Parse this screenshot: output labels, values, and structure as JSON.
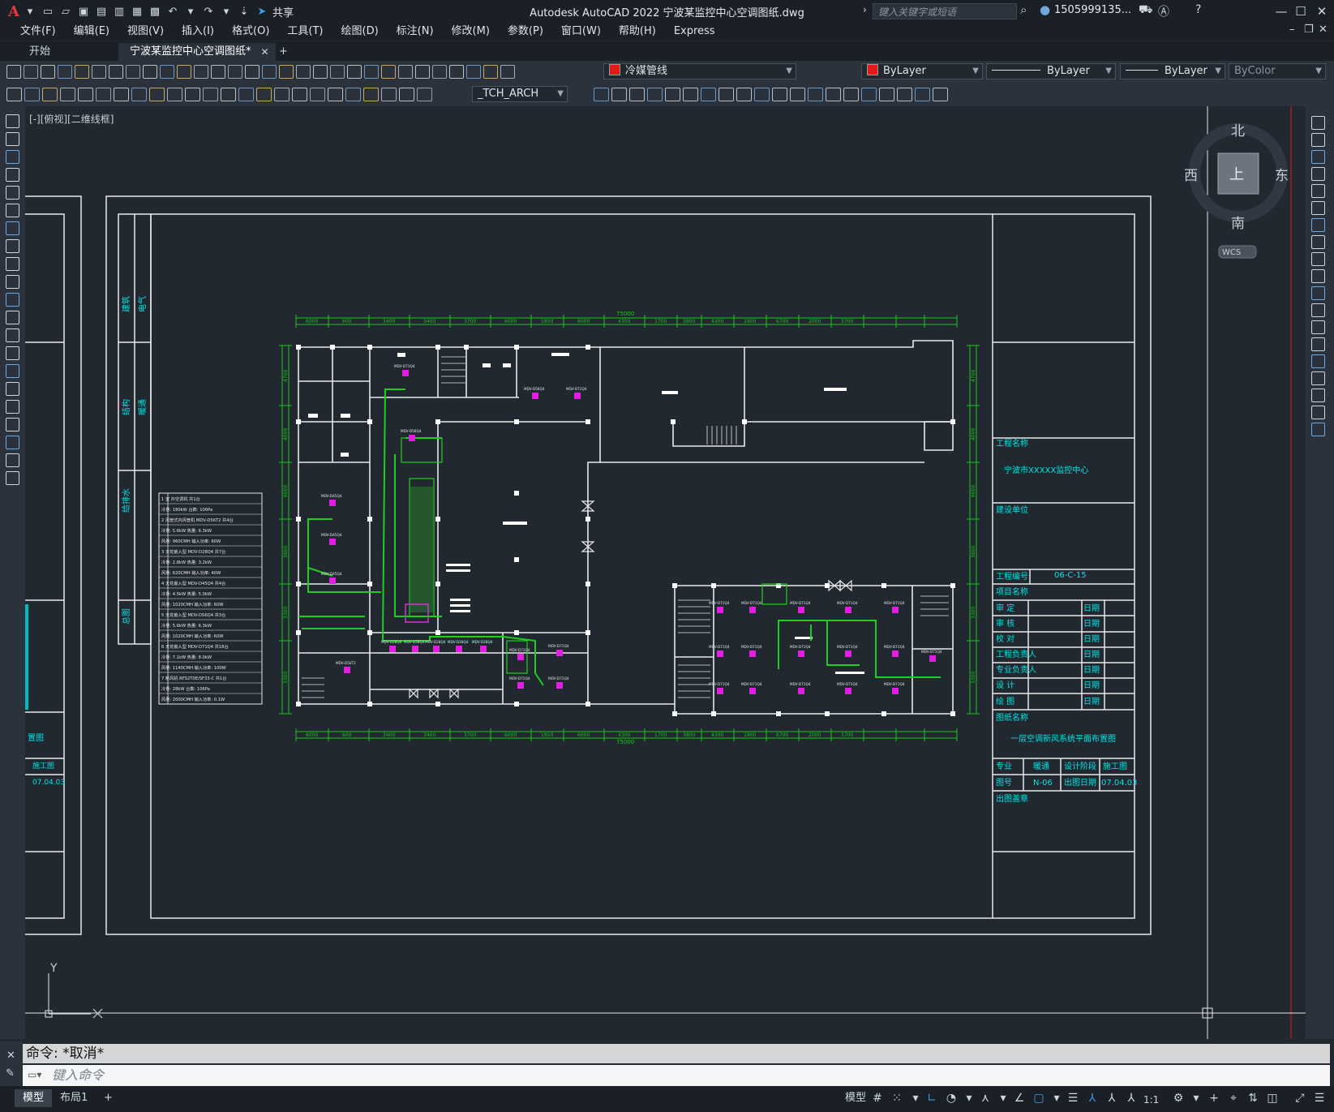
{
  "app": {
    "title": "Autodesk AutoCAD 2022    宁波某监控中心空调图纸.dwg",
    "logo": "A",
    "share_label": "共享",
    "search_placeholder": "键入关键字或短语",
    "account": "1505999135...",
    "accent": "#3d9be9"
  },
  "menu": [
    "文件(F)",
    "编辑(E)",
    "视图(V)",
    "插入(I)",
    "格式(O)",
    "工具(T)",
    "绘图(D)",
    "标注(N)",
    "修改(M)",
    "参数(P)",
    "窗口(W)",
    "帮助(H)",
    "Express"
  ],
  "tabs": {
    "start": "开始",
    "active": "宁波某监控中心空调图纸*",
    "close": "✕",
    "add": "+"
  },
  "toolbar": {
    "layer_name": "冷媒管线",
    "color": "ByLayer",
    "linetype": "ByLayer",
    "lineweight": "ByLayer",
    "plotstyle": "ByColor",
    "text_style": "_TCH_ARCH",
    "layer_color": "#e31a1a"
  },
  "viewport": {
    "label": "[-][俯视][二维线框]",
    "compass": {
      "north": "北",
      "south": "南",
      "east": "东",
      "west": "西",
      "center": "上"
    },
    "wcs": "WCS",
    "ucs_x": "X",
    "ucs_y": "Y"
  },
  "drawing": {
    "title_block": {
      "project_label": "工程名称",
      "project_value": "宁波市XXXXX监控中心",
      "client_label": "建设单位",
      "job_no_label": "工程编号",
      "job_no_value": "06-C-15",
      "item_label": "项目名称",
      "rows": [
        "审  定",
        "审  核",
        "校  对",
        "工程负责人",
        "专业负责人",
        "设  计",
        "绘  图"
      ],
      "date_label": "日期",
      "drawing_name_label": "图纸名称",
      "drawing_name_value": "一层空调新风系统平面布置图",
      "specialty_label": "专业",
      "specialty_value": "暖通",
      "stage_label": "设计阶段",
      "stage_value": "施工图",
      "drawing_no_label": "图号",
      "drawing_no_value": "N-06",
      "issue_date_label": "出图日期",
      "issue_date_value": "07.04.03",
      "stamp_label": "出图盖章"
    },
    "left_partial": {
      "stage": "施工图",
      "date": "07.04.03",
      "name_fragment": "置图"
    },
    "sign_column": [
      "建筑",
      "结构",
      "给排水",
      "电气",
      "暖通",
      "总图"
    ],
    "total_dim": "75000",
    "dims_top": [
      "6000",
      "600",
      "3400",
      "3400",
      "3700",
      "6000",
      "1950",
      "6000",
      "4300",
      "1700",
      "3800",
      "4300",
      "1900",
      "6700",
      "2000",
      "3700"
    ],
    "dims_right": [
      "4700",
      "4000",
      "6000",
      "3800",
      "3300",
      "3300",
      "1900"
    ],
    "units": [
      "MDV-D71Q4",
      "MDV-D56Q4",
      "MDV-D45Q4",
      "MDV-D28Q4",
      "MDV-D36T2",
      "MDV-D56T2",
      "MDV-D140T2",
      "MDV-D71T2",
      "MDV-D28T2",
      "RFS2T0E/SF33-C"
    ],
    "legend": [
      "1 室 外空调机                  共1台",
      "  冷量: 180kW    台数: 106Pa",
      "2 风管式内风管机  MDV-D56T2        共4台",
      "  冷量: 5.6kW    热量: 6.3kW",
      "  风量: 960CMH     输入功率: 60W",
      "3 天花嵌入型  MDV-D28Q4          共7台",
      "  冷量: 2.8kW    热量: 3.2kW",
      "  风量: 620CMH     输入功率: 40W",
      "4 天花嵌入型  MDV-D45Q4          共4台",
      "  冷量: 4.5kW    热量: 5.0kW",
      "  风量: 1020CMH    输入功率: 60W",
      "5 天花嵌入型  MDV-D56Q4          共3台",
      "  冷量: 5.6kW    热量: 6.3kW",
      "  风量: 1020CMH    输入功率: 60W",
      "6 天花嵌入型  MDV-D71Q4          共18台",
      "  冷量: 7.1kW    热量: 8.0kW",
      "  风量: 1140CMH    输入功率: 100W",
      "7 新风机  RFS2T0E/SF33-C          共1台",
      "  冷量: 28kW    台数: 106Pa",
      "  风量: 2000CMH    输入功率: 0.1W"
    ]
  },
  "command": {
    "history": "命令: *取消*",
    "input_placeholder": "键入命令"
  },
  "status": {
    "layouts": [
      "模型",
      "布局1"
    ],
    "add_layout": "+",
    "model_label": "模型",
    "scale": "1:1"
  }
}
